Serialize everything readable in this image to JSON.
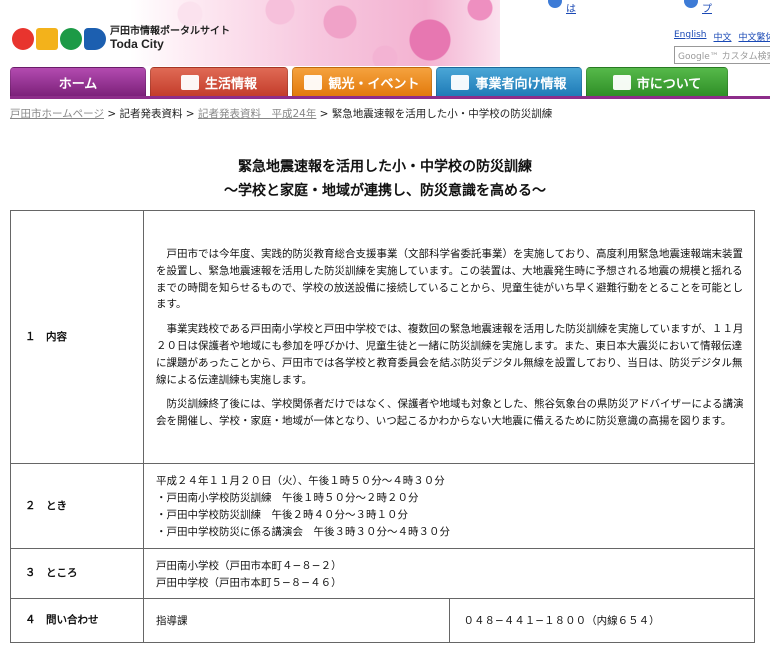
{
  "header": {
    "logo_jp": "戸田市情報ポータルサイト",
    "logo_en": "Toda City",
    "util_link_1": "は",
    "util_link_2": "プ",
    "lang": [
      "English",
      "中文",
      "中文繁体"
    ],
    "search_placeholder": "Google™ カスタム検索"
  },
  "nav": {
    "tabs": [
      "ホーム",
      "生活情報",
      "観光・イベント",
      "事業者向け情報",
      "市について"
    ]
  },
  "breadcrumb": {
    "home": "戸田市ホームページ",
    "sep": " > ",
    "press": "記者発表資料",
    "press_year": "記者発表資料　平成24年",
    "current": "緊急地震速報を活用した小・中学校の防災訓練"
  },
  "article": {
    "title": "緊急地震速報を活用した小・中学校の防災訓練",
    "subtitle": "〜学校と家庭・地域が連携し、防災意識を高める〜",
    "rows": {
      "content_label": "１　内容",
      "content_p1": "戸田市では今年度、実践的防災教育総合支援事業（文部科学省委託事業）を実施しており、高度利用緊急地震速報端末装置を設置し、緊急地震速報を活用した防災訓練を実施しています。この装置は、大地震発生時に予想される地震の規模と揺れるまでの時間を知らせるもので、学校の放送設備に接続していることから、児童生徒がいち早く避難行動をとることを可能とします。",
      "content_p2": "事業実践校である戸田南小学校と戸田中学校では、複数回の緊急地震速報を活用した防災訓練を実施していますが、１１月２０日は保護者や地域にも参加を呼びかけ、児童生徒と一緒に防災訓練を実施します。また、東日本大震災において情報伝達に課題があったことから、戸田市では各学校と教育委員会を結ぶ防災デジタル無線を設置しており、当日は、防災デジタル無線による伝達訓練も実施します。",
      "content_p3": "防災訓練終了後には、学校関係者だけではなく、保護者や地域も対象とした、熊谷気象台の県防災アドバイザーによる講演会を開催し、学校・家庭・地域が一体となり、いつ起こるかわからない大地震に備えるために防災意識の高揚を図ります。",
      "when_label": "２　とき",
      "when_lines": [
        "平成２４年１１月２０日（火）、午後１時５０分〜４時３０分",
        "・戸田南小学校防災訓練　午後１時５０分〜２時２０分",
        "・戸田中学校防災訓練　午後２時４０分〜３時１０分",
        "・戸田中学校防災に係る講演会　午後３時３０分〜４時３０分"
      ],
      "where_label": "３　ところ",
      "where_lines": [
        "戸田南小学校（戸田市本町４−８−２）",
        "戸田中学校（戸田市本町５−８−４６）"
      ],
      "contact_label": "４　問い合わせ",
      "contact_dept": "指導課",
      "contact_tel": "０４８−４４１−１８００（内線６５４）"
    }
  }
}
